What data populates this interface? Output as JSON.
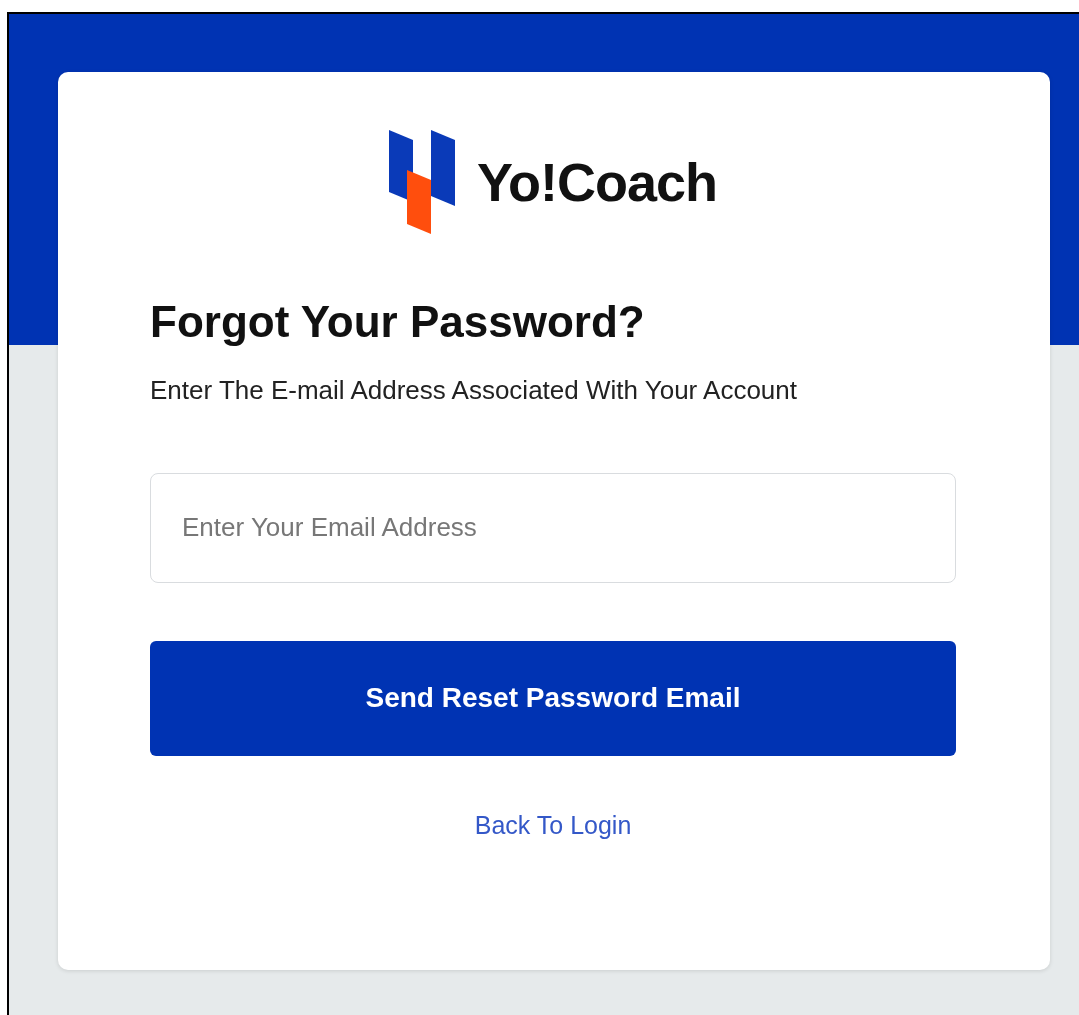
{
  "logo": {
    "text": "Yo!Coach"
  },
  "heading": "Forgot Your Password?",
  "subtitle": "Enter The E-mail Address Associated With Your Account",
  "email_field": {
    "placeholder": "Enter Your Email Address"
  },
  "submit_button": "Send Reset Password Email",
  "back_link": "Back To Login"
}
